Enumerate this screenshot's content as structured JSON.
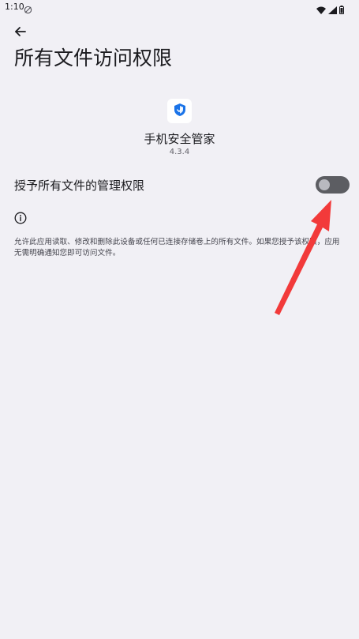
{
  "status_bar": {
    "time": "1:10"
  },
  "header": {
    "title": "所有文件访问权限"
  },
  "app": {
    "name": "手机安全管家",
    "version": "4.3.4"
  },
  "permission": {
    "label": "授予所有文件的管理权限",
    "enabled": false
  },
  "info": {
    "description": "允许此应用读取、修改和删除此设备或任何已连接存储卷上的所有文件。如果您授予该权限，应用无需明确通知您即可访问文件。"
  },
  "colors": {
    "background": "#f1f0f5",
    "toggle_track": "#5c5d62",
    "toggle_thumb": "#b8b9bf",
    "annotation_arrow": "#f23a3a",
    "app_icon_blue": "#1a73e8"
  },
  "icons": {
    "back": "arrow-left-icon",
    "info": "info-circle-icon",
    "app": "shield-check-icon",
    "sync": "sync-off-icon",
    "wifi": "wifi-icon",
    "signal": "signal-icon",
    "battery": "battery-icon"
  }
}
